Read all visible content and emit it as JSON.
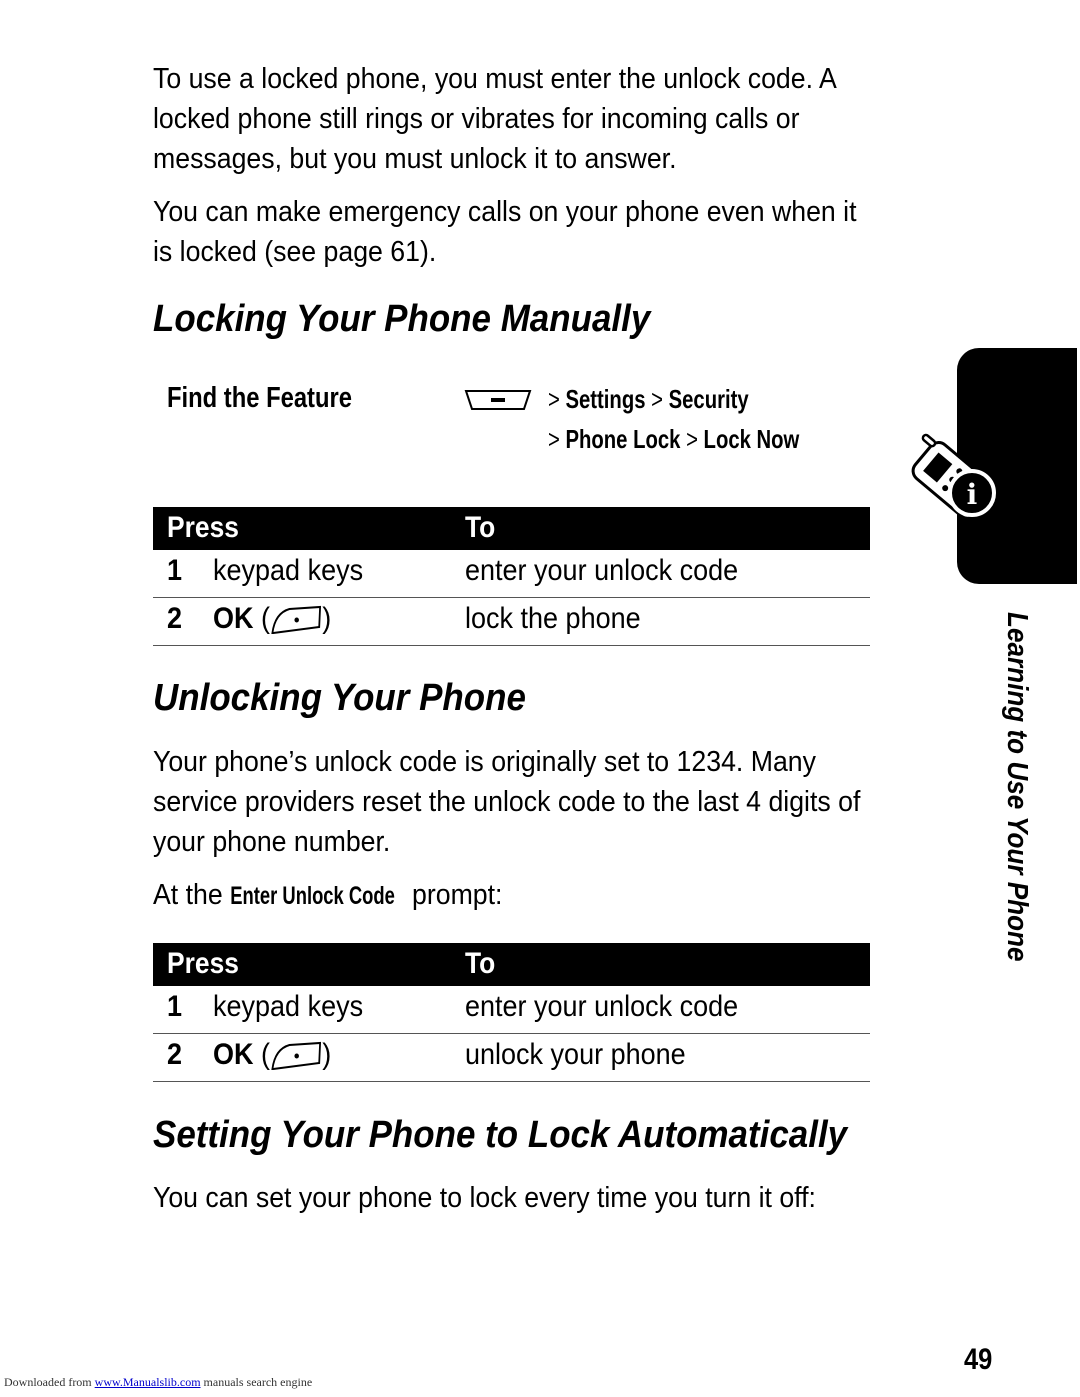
{
  "intro": {
    "p1": "To use a locked phone, you must enter the unlock code. A locked phone still rings or vibrates for incoming calls or messages, but you must unlock it to answer.",
    "p2": "You can make emergency calls on your phone even when it is locked (see page 61)."
  },
  "locking": {
    "heading": "Locking Your Phone Manually",
    "find_label": "Find the Feature",
    "menu_icon": "menu-key-icon",
    "path_line1": [
      ">",
      "Settings",
      ">",
      "Security"
    ],
    "path_line2": [
      ">",
      "Phone Lock",
      ">",
      "Lock Now"
    ],
    "table": {
      "headers": [
        "Press",
        "To"
      ],
      "rows": [
        {
          "num": "1",
          "press": "keypad keys",
          "to": "enter your unlock code"
        },
        {
          "num": "2",
          "press": "OK",
          "key_icon": "right-soft-key-icon",
          "to": "lock the phone"
        }
      ]
    }
  },
  "unlocking": {
    "heading": "Unlocking Your Phone",
    "p1": "Your phone’s unlock code is originally set to 1234. Many service providers reset the unlock code to the last 4 digits of your phone number.",
    "prompt_prefix": "At the ",
    "prompt_name": "Enter Unlock Code",
    "prompt_suffix": " prompt:",
    "table": {
      "headers": [
        "Press",
        "To"
      ],
      "rows": [
        {
          "num": "1",
          "press": "keypad keys",
          "to": "enter your unlock code"
        },
        {
          "num": "2",
          "press": "OK",
          "key_icon": "right-soft-key-icon",
          "to": "unlock your phone"
        }
      ]
    }
  },
  "auto_lock": {
    "heading": "Setting Your Phone to Lock Automatically",
    "p1": "You can set your phone to lock every time you turn it off:"
  },
  "sidebar": {
    "icon": "phone-info-icon",
    "section_title": "Learning to Use Your Phone"
  },
  "page_number": "49",
  "footer": {
    "prefix": "Downloaded from ",
    "link": "www.Manualslib.com",
    "suffix": " manuals search engine"
  }
}
